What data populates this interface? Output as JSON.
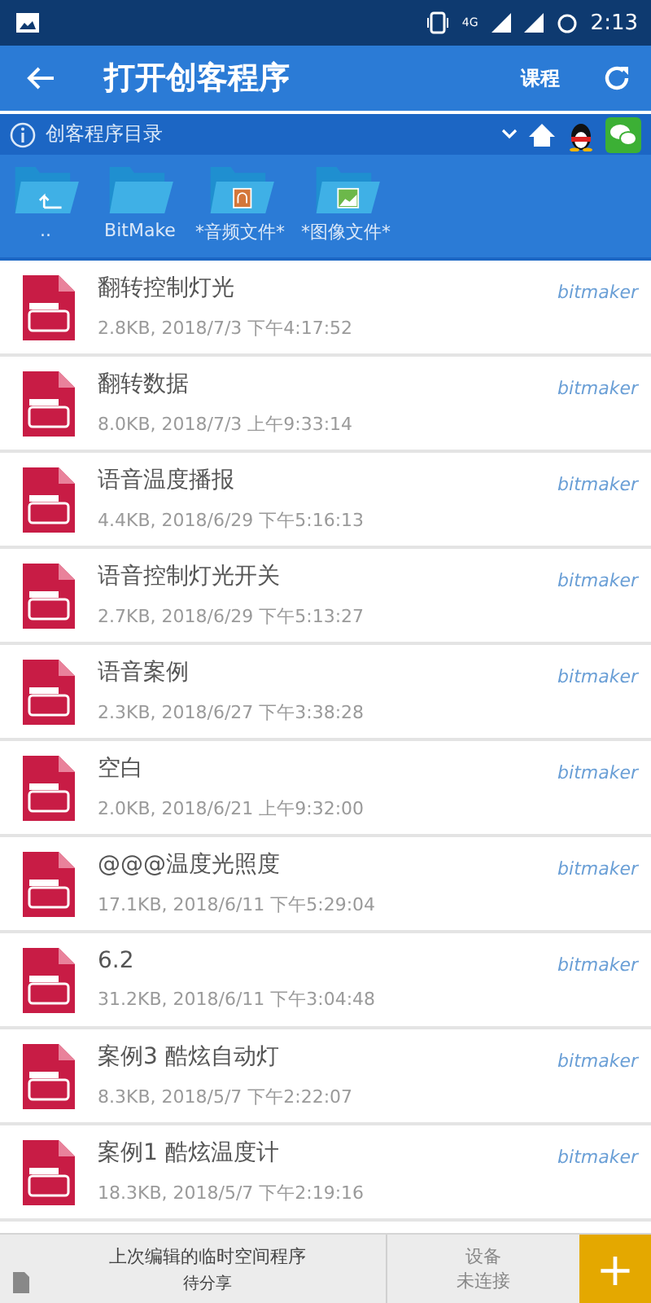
{
  "status_bar": {
    "network": "4G",
    "time": "2:13"
  },
  "app_bar": {
    "title": "打开创客程序",
    "action": "课程"
  },
  "path_bar": {
    "label": "创客程序目录"
  },
  "folders": [
    {
      "kind": "up",
      "label": ".."
    },
    {
      "kind": "plain",
      "label": "BitMake"
    },
    {
      "kind": "audio",
      "label": "*音频文件*"
    },
    {
      "kind": "image",
      "label": "*图像文件*"
    }
  ],
  "files": [
    {
      "name": "翻转控制灯光",
      "details": "2.8KB, 2018/7/3 下午4:17:52",
      "author": "bitmaker"
    },
    {
      "name": "翻转数据",
      "details": "8.0KB, 2018/7/3 上午9:33:14",
      "author": "bitmaker"
    },
    {
      "name": "语音温度播报",
      "details": "4.4KB, 2018/6/29 下午5:16:13",
      "author": "bitmaker"
    },
    {
      "name": "语音控制灯光开关",
      "details": "2.7KB, 2018/6/29 下午5:13:27",
      "author": "bitmaker"
    },
    {
      "name": "语音案例",
      "details": "2.3KB, 2018/6/27 下午3:38:28",
      "author": "bitmaker"
    },
    {
      "name": "空白",
      "details": "2.0KB, 2018/6/21 上午9:32:00",
      "author": "bitmaker"
    },
    {
      "name": "@@@温度光照度",
      "details": "17.1KB, 2018/6/11 下午5:29:04",
      "author": "bitmaker"
    },
    {
      "name": "6.2",
      "details": "31.2KB, 2018/6/11 下午3:04:48",
      "author": "bitmaker"
    },
    {
      "name": "案例3 酷炫自动灯",
      "details": "8.3KB, 2018/5/7 下午2:22:07",
      "author": "bitmaker"
    },
    {
      "name": "案例1 酷炫温度计",
      "details": "18.3KB, 2018/5/7 下午2:19:16",
      "author": "bitmaker"
    }
  ],
  "bottom_bar": {
    "recent_title": "上次编辑的临时空间程序",
    "recent_status": "待分享",
    "device_label": "设备",
    "device_status": "未连接",
    "add": "+"
  }
}
